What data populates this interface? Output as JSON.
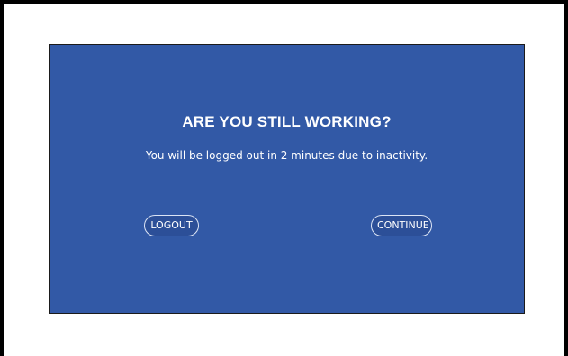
{
  "dialog": {
    "title": "ARE YOU STILL WORKING?",
    "message": "You will be logged out in 2 minutes due to inactivity.",
    "buttons": {
      "logout_label": "LOGOUT",
      "continue_label": "CONTINUE"
    }
  },
  "colors": {
    "dialog_background": "#3259a6",
    "text": "#ffffff",
    "page_frame": "#000000"
  }
}
